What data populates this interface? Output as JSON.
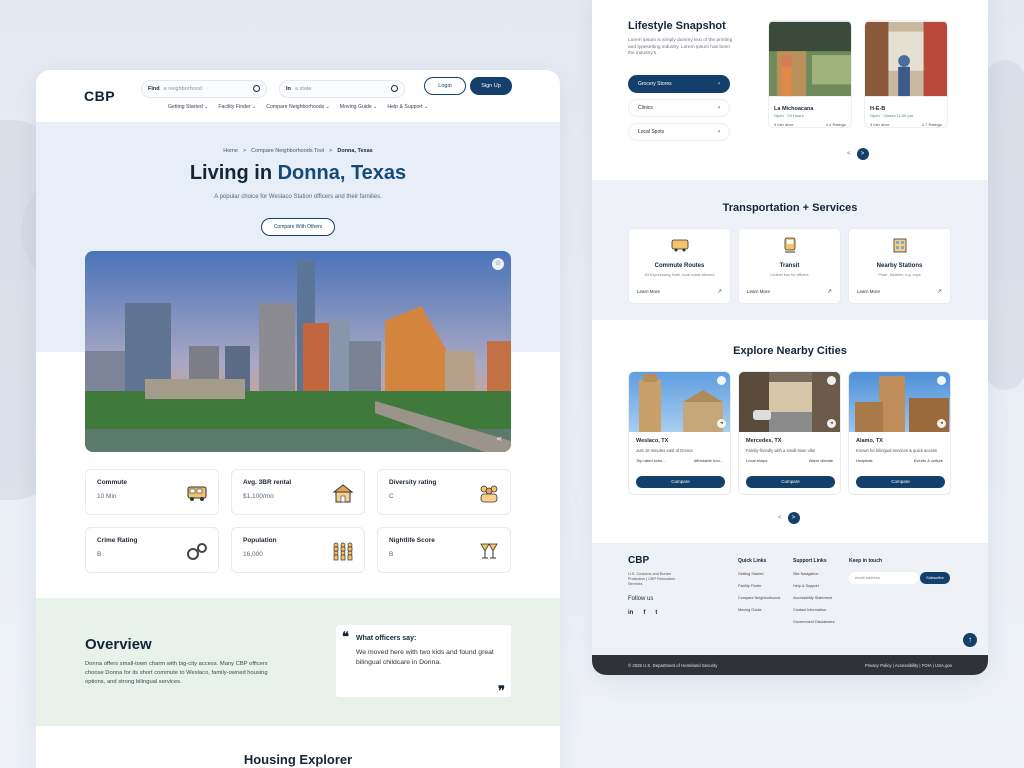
{
  "colors": {
    "primary": "#143f6b",
    "accent": "#144a7a",
    "overview_bg": "#e9f2ea",
    "hero_bg": "#e8eef7"
  },
  "header": {
    "logo": "CBP",
    "search1": {
      "label": "Find",
      "placeholder": "a neighborhood"
    },
    "search2": {
      "label": "In",
      "placeholder": "a state"
    },
    "login": "Login",
    "signup": "Sign Up",
    "menu": [
      "Getting Started",
      "Facility Finder",
      "Compare Neighborhoods",
      "Moving Guide",
      "Help & Support"
    ]
  },
  "breadcrumb": {
    "items": [
      "Home",
      "Compare Neighborhoods Tool",
      "Donna, Texas"
    ],
    "sep": ">"
  },
  "hero": {
    "title_prefix": "Living in ",
    "title_accent": "Donna, Texas",
    "subtitle": "A popular choice for Weslaco Station officers and their families.",
    "compare_button": "Compare With Others"
  },
  "stats": [
    {
      "title": "Commute",
      "value": "10 Min",
      "icon": "commute-icon"
    },
    {
      "title": "Avg. 3BR rental",
      "value": "$1,100/mo",
      "icon": "house-icon"
    },
    {
      "title": "Diversity rating",
      "value": "C",
      "icon": "diversity-icon"
    },
    {
      "title": "Crime Rating",
      "value": "B",
      "icon": "handcuffs-icon"
    },
    {
      "title": "Population",
      "value": "16,000",
      "icon": "population-icon"
    },
    {
      "title": "Nightlife Score",
      "value": "B",
      "icon": "nightlife-icon"
    }
  ],
  "overview": {
    "title": "Overview",
    "text": "Donna offers small-town charm with big-city access. Many CBP officers choose Donna for its short commute to Weslaco, family-owned housing options, and strong bilingual services.",
    "quote_title": "What officers say:",
    "quote_body": "We moved here with two kids and found great bilingual childcare in Donna."
  },
  "housing_title": "Housing Explorer",
  "lifestyle": {
    "title": "Lifestyle Snapshot",
    "desc": "Lorem Ipsum is simply dummy text of the printing and typesetting industry. Lorem Ipsum has been the industry's",
    "buttons": [
      "Grocery Stores",
      "Clinics",
      "Local Spots"
    ],
    "stores": [
      {
        "name": "La Michoacana",
        "hours": "Open · 24 Hours",
        "dist": "5 min drive",
        "rating": "4.4 Ratings"
      },
      {
        "name": "H-E-B",
        "hours": "Open · Closes 11:00 pm",
        "dist": "3 min drive",
        "rating": "4.7 Ratings"
      }
    ],
    "pager_prev": "<",
    "pager_next": ">"
  },
  "transport": {
    "title": "Transportation + Services",
    "cards": [
      {
        "title": "Commute Routes",
        "desc": "83 Expressway, Bath, local roads allowed",
        "link": "Learn More",
        "icon": "bus-icon"
      },
      {
        "title": "Transit",
        "desc": "Limited bus for officers",
        "link": "Learn More",
        "icon": "transit-icon"
      },
      {
        "title": "Nearby Stations",
        "desc": "Pharr, McAllen, e.g. cops",
        "link": "Learn More",
        "icon": "station-icon"
      }
    ]
  },
  "cities": {
    "title": "Explore Nearby Cities",
    "items": [
      {
        "name": "Weslaco, TX",
        "desc": "Just 10 minutes east of Donna",
        "tag1": "Top rated scho...",
        "tag2": "Affordable hou...",
        "button": "Compare"
      },
      {
        "name": "Mercedes, TX",
        "desc": "Family-friendly with a small-town vibe",
        "tag1": "Local shops",
        "tag2": "Warm climate",
        "button": "Compare"
      },
      {
        "name": "Alamo, TX",
        "desc": "Known for bilingual services & quick access",
        "tag1": "Hospitals",
        "tag2": "Events & culture",
        "button": "Compare"
      }
    ],
    "pager_prev": "<",
    "pager_next": ">"
  },
  "footer": {
    "logo": "CBP",
    "org": "U.S. Customs and Border Protection | CBP Relocation Services",
    "follow": "Follow us",
    "social": [
      "in",
      "f",
      "t"
    ],
    "quick": {
      "title": "Quick Links",
      "items": [
        "Getting Started",
        "Facility Finder",
        "Compare Neighborhoods",
        "Moving Guide"
      ]
    },
    "support": {
      "title": "Support Links",
      "items": [
        "Site Navigation",
        "Help & Support",
        "Accessibility Statement",
        "Contact Information",
        "Government Disclaimers"
      ]
    },
    "keep": "Keep in touch",
    "email_placeholder": "email address",
    "subscribe": "Subscribe",
    "copyright": "© 2025 U.S. Department of Homeland Security",
    "legal": "Privacy Policy | Accessibility | FOIA | USA.gov"
  }
}
